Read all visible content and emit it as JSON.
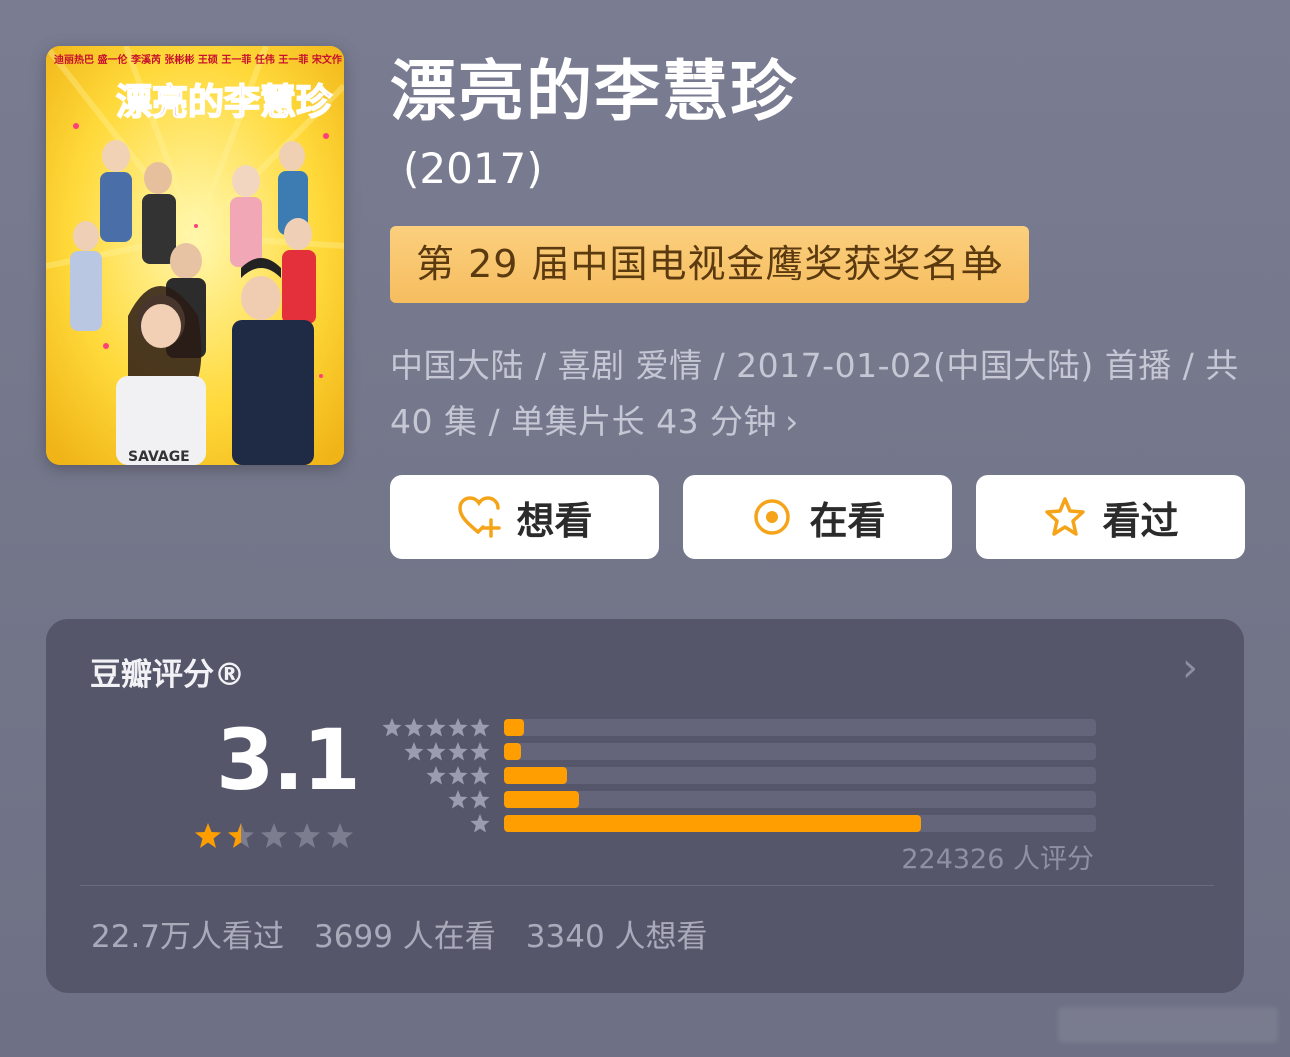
{
  "poster": {
    "title_art": "漂亮的李慧珍",
    "top_names": "迪丽热巴   盛一伦 李溪芮 张彬彬 王硕 王一菲 任伟 王一菲 宋文作"
  },
  "title": "漂亮的李慧珍",
  "year": "(2017)",
  "award": {
    "label": "第 29 届中国电视金鹰奖获奖名单",
    "chevron": "›"
  },
  "meta": {
    "text": "中国大陆 / 喜剧 爱情 / 2017-01-02(中国大陆) 首播 / 共 40 集 / 单集片长 43 分钟",
    "chevron": "›"
  },
  "actions": [
    {
      "label": "想看",
      "icon": "heart-plus-icon"
    },
    {
      "label": "在看",
      "icon": "target-icon"
    },
    {
      "label": "看过",
      "icon": "star-outline-icon"
    }
  ],
  "rating": {
    "title": "豆瓣评分®",
    "chevron": "›",
    "score": "3.1",
    "stars": 1.5,
    "distribution": [
      {
        "stars": 5,
        "fraction": 0.034
      },
      {
        "stars": 4,
        "fraction": 0.028
      },
      {
        "stars": 3,
        "fraction": 0.106
      },
      {
        "stars": 2,
        "fraction": 0.127
      },
      {
        "stars": 1,
        "fraction": 0.705
      }
    ],
    "count_label": "224326 人评分",
    "stats": [
      "22.7万人看过",
      "3699 人在看",
      "3340 人想看"
    ]
  },
  "colors": {
    "accent": "#ff9e00",
    "award_bg": "#f6bd5f",
    "card_bg": "#56566a"
  }
}
